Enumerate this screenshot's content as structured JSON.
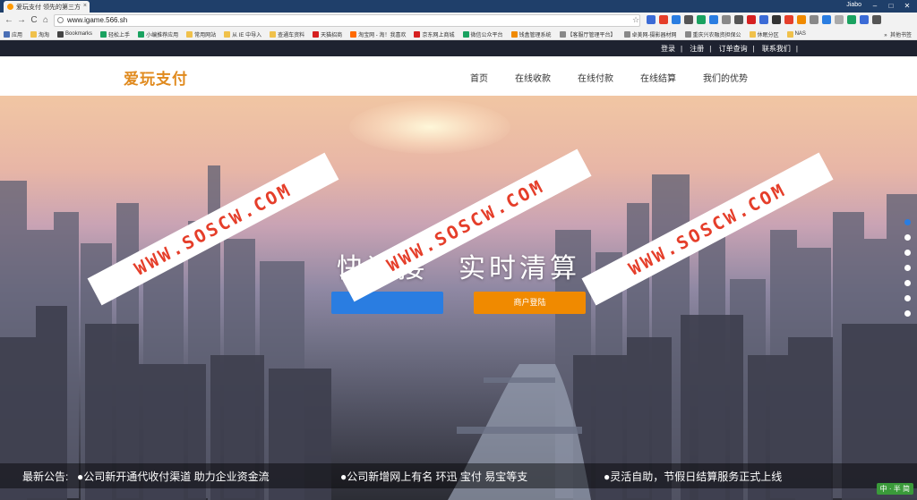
{
  "browser": {
    "tab_title": "爱玩支付 领先的第三方",
    "tab_close": "×",
    "user": "Jiabo",
    "win_min": "–",
    "win_max": "□",
    "win_close": "✕",
    "url": "www.igame.566.sh",
    "back": "←",
    "forward": "→",
    "reload": "C",
    "home": "⌂",
    "star": "☆",
    "bookmarks": [
      {
        "label": "应用",
        "color": "#4a6fb5"
      },
      {
        "label": "淘淘",
        "color": "#f0c14b"
      },
      {
        "label": "Bookmarks",
        "color": "#444444"
      },
      {
        "label": "轻松上手",
        "color": "#1aa260"
      },
      {
        "label": "小编推荐应用",
        "color": "#1aa260"
      },
      {
        "label": "常用网站",
        "color": "#f0c14b"
      },
      {
        "label": "从 IE 中导入",
        "color": "#f0c14b"
      },
      {
        "label": "查通车资料",
        "color": "#f0c14b"
      },
      {
        "label": "天猫招商",
        "color": "#d62020"
      },
      {
        "label": "淘宝网 - 淘！我喜欢",
        "color": "#ff6a00"
      },
      {
        "label": "京东网上商城",
        "color": "#d62020"
      },
      {
        "label": "微信公众平台",
        "color": "#1aa260"
      },
      {
        "label": "钱盒管理系统",
        "color": "#f08a00"
      },
      {
        "label": "【客服厅管理平台】",
        "color": "#888888"
      },
      {
        "label": "卓美网-摄影器材网",
        "color": "#888888"
      },
      {
        "label": "重庆兴农融资担保公",
        "color": "#888888"
      },
      {
        "label": "休眠分区",
        "color": "#f0c14b"
      },
      {
        "label": "NAS",
        "color": "#f0c14b"
      }
    ],
    "bookmarks_more": "»",
    "other_bookmarks": "其他书签"
  },
  "site": {
    "top_links": [
      "登录",
      "注册",
      "订单查询",
      "联系我们"
    ],
    "separator": "|",
    "logo": "爱玩支付",
    "menu": [
      "首页",
      "在线收款",
      "在线付款",
      "在线结算",
      "我们的优势"
    ],
    "hero_title": "快速接　实时清算",
    "merchant_login": "商户登陆",
    "watermark": "WWW.SOSCW.COM",
    "notice_label": "最新公告:",
    "notices": [
      "●公司新开通代收付渠道 助力企业资金流",
      "●公司新增网上有名 环迅 宝付 易宝等支",
      "●灵活自助，节假日结算服务正式上线"
    ],
    "ime": "中 · 半 简"
  },
  "colors": {
    "accent_blue": "#2a7de1",
    "accent_orange": "#f08a00",
    "logo_orange": "#e08a1e",
    "watermark_red": "#e53e2a"
  }
}
